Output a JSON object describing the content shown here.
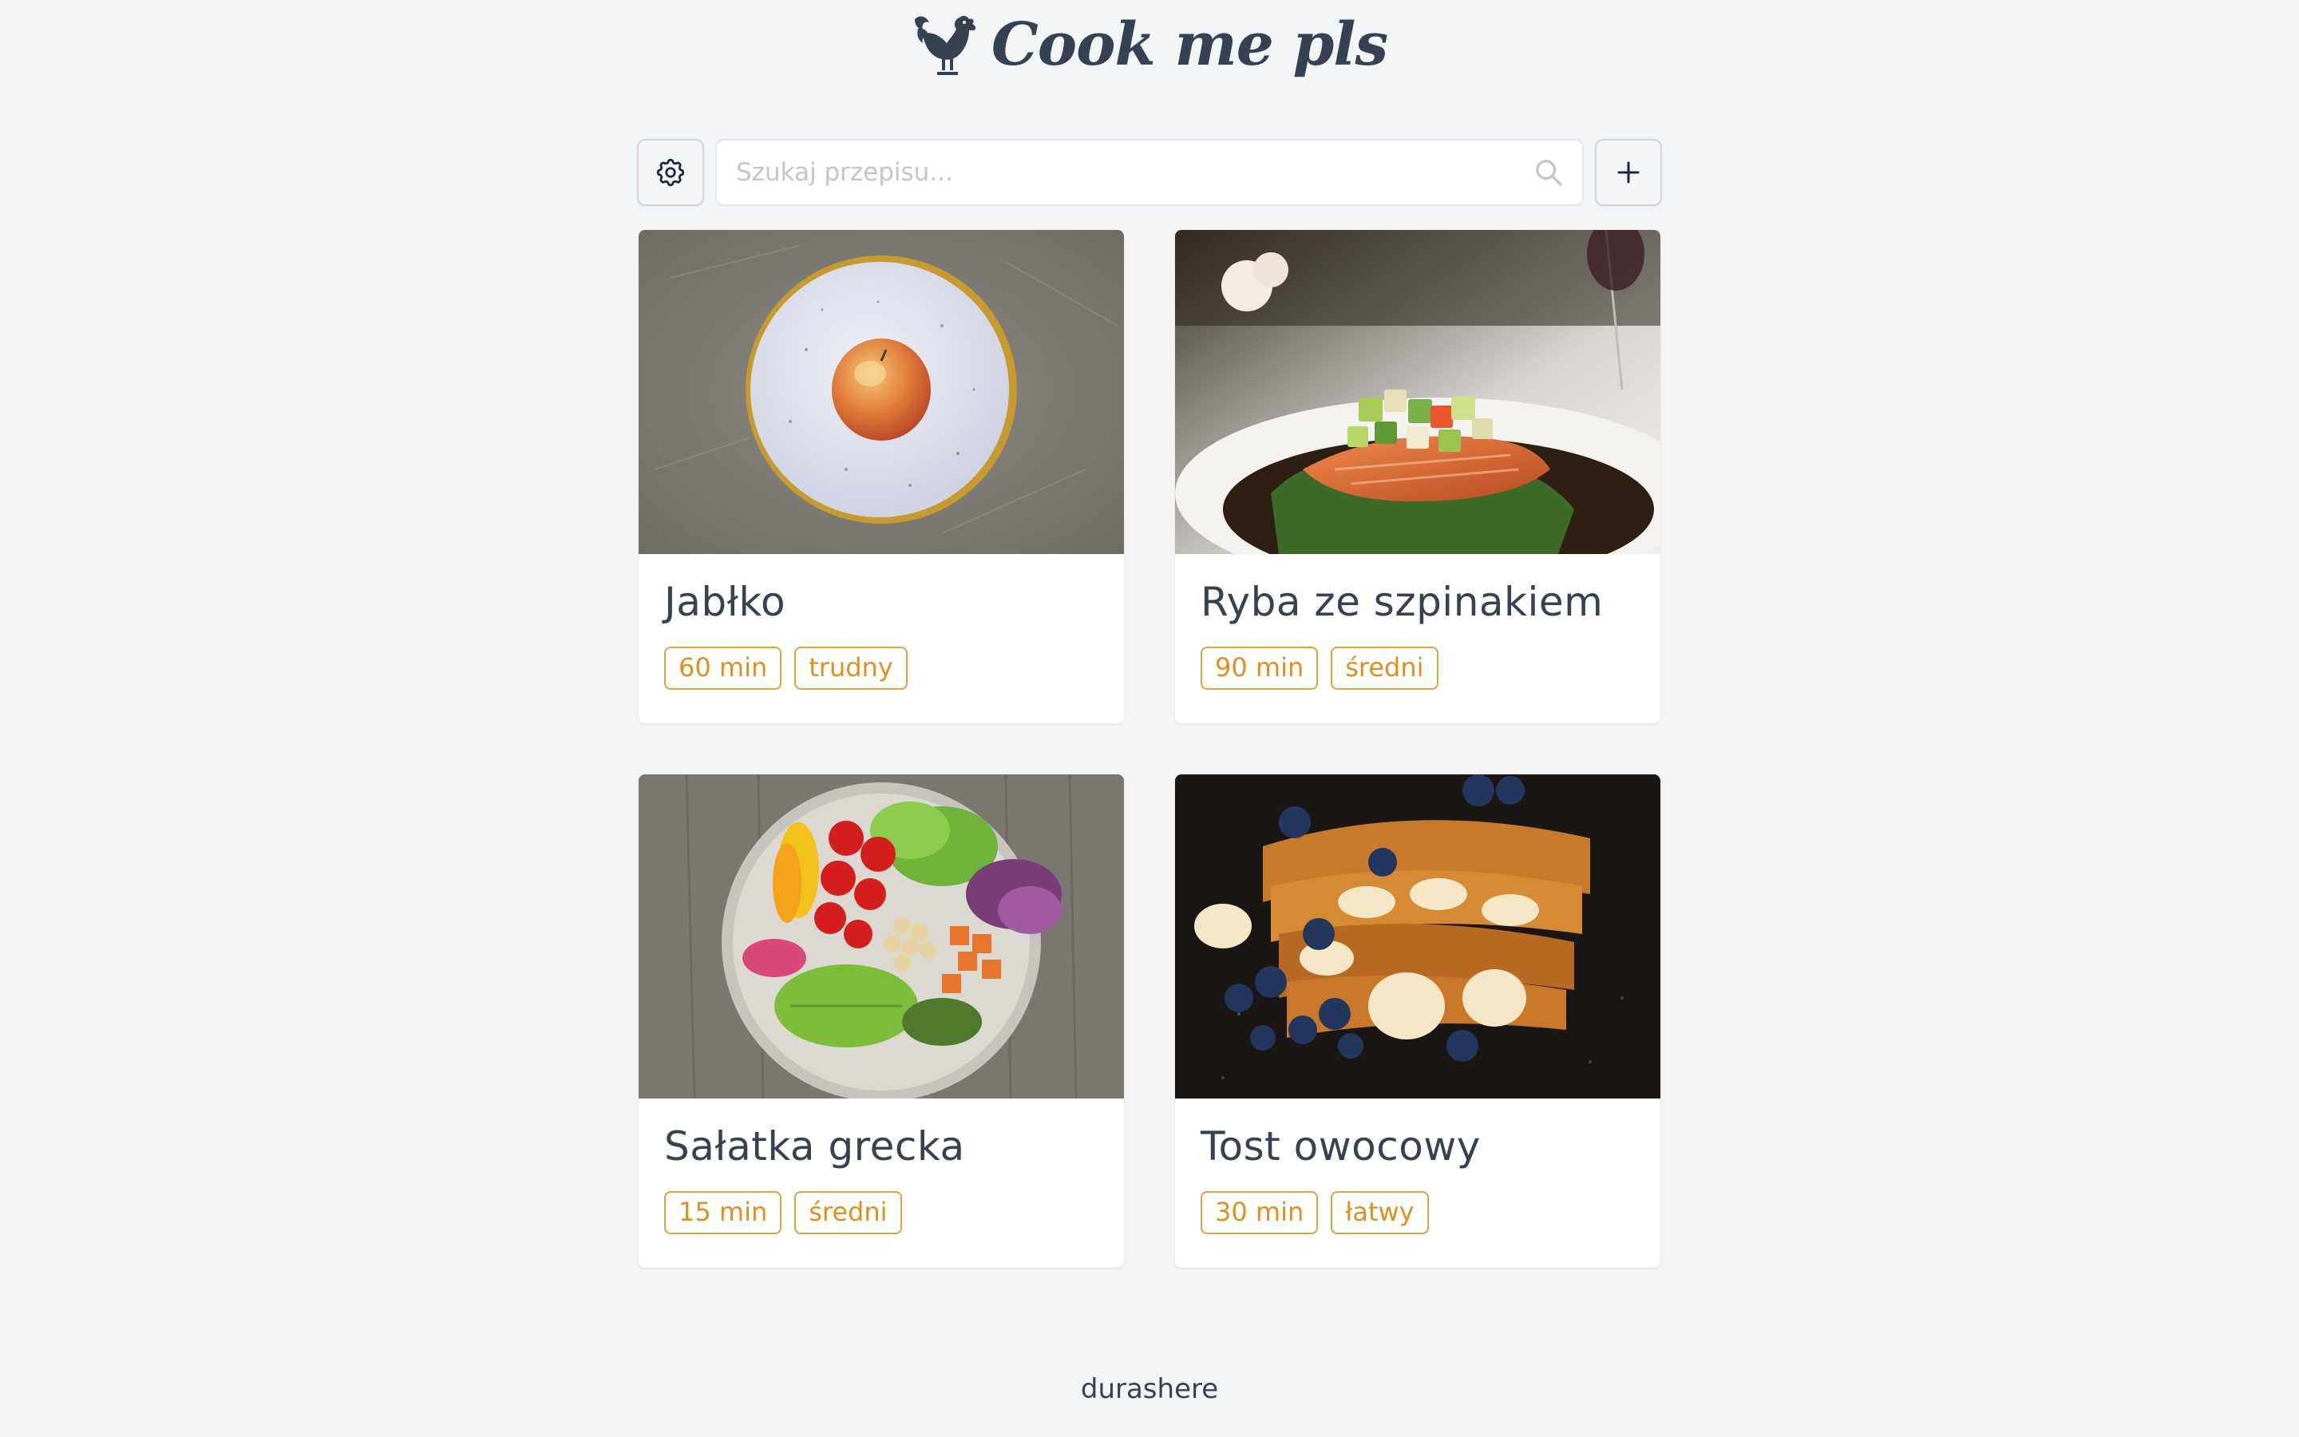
{
  "header": {
    "logo_text": "Cook me pls",
    "logo_icon": "rooster-icon"
  },
  "toolbar": {
    "settings_icon": "gear-icon",
    "search_placeholder": "Szukaj przepisu...",
    "search_value": "",
    "search_icon": "search-icon",
    "add_icon": "plus-icon"
  },
  "recipes": [
    {
      "title": "Jabłko",
      "time": "60 min",
      "difficulty": "trudny",
      "image": "apple-on-plate"
    },
    {
      "title": "Ryba ze szpinakiem",
      "time": "90 min",
      "difficulty": "średni",
      "image": "salmon-with-spinach"
    },
    {
      "title": "Sałatka grecka",
      "time": "15 min",
      "difficulty": "średni",
      "image": "salad-bowl"
    },
    {
      "title": "Tost owocowy",
      "time": "30 min",
      "difficulty": "łatwy",
      "image": "french-toast-with-fruit"
    }
  ],
  "footer": {
    "text": "durashere"
  },
  "colors": {
    "background": "#f3f4f6",
    "text": "#374151",
    "tag_accent": "#e08f1f"
  }
}
